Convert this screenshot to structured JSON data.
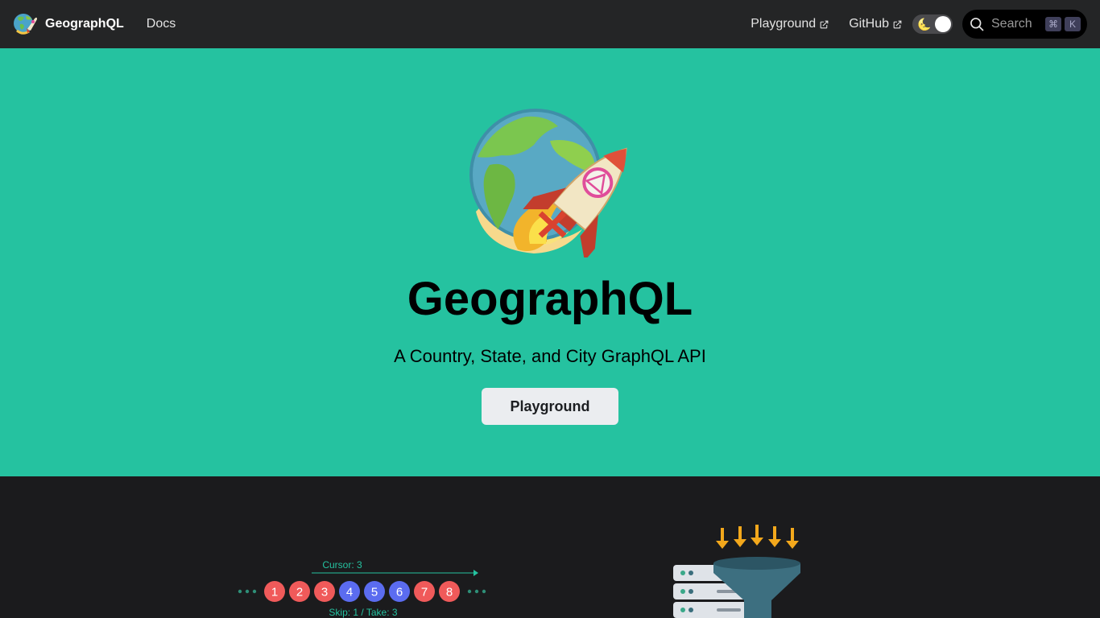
{
  "navbar": {
    "brand": "GeographQL",
    "docs": "Docs",
    "playground": "Playground",
    "github": "GitHub",
    "theme_icon": "moon-icon",
    "search_label": "Search",
    "search_keys": [
      "⌘",
      "K"
    ]
  },
  "hero": {
    "title": "GeographQL",
    "tagline": "A Country, State, and City GraphQL API",
    "button": "Playground"
  },
  "features": {
    "pagination": {
      "cursor_label": "Cursor: 3",
      "skip_take_label": "Skip: 1 / Take: 3",
      "items": [
        "1",
        "2",
        "3",
        "4",
        "5",
        "6",
        "7",
        "8"
      ]
    }
  },
  "colors": {
    "accent": "#25c2a0",
    "navbar_bg": "#242526",
    "page_bg": "#1b1b1d",
    "red_item": "#f05a5a",
    "blue_item": "#5b6cf0",
    "arrow_orange": "#f3a81c"
  }
}
